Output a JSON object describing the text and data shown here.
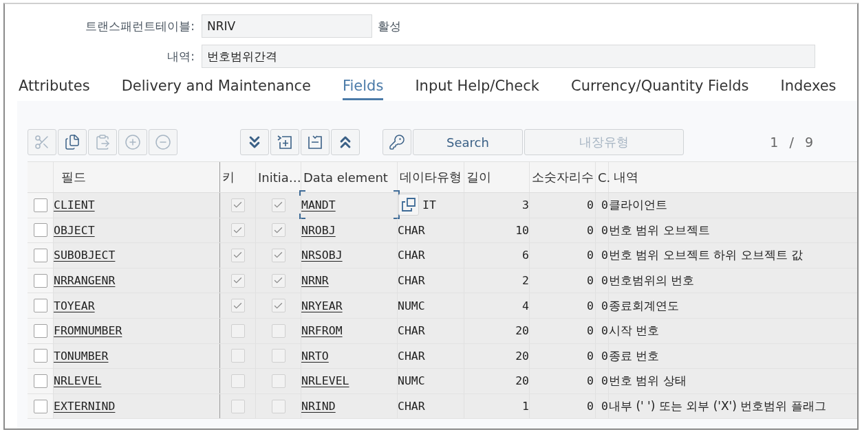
{
  "header": {
    "fields": [
      {
        "label": "트랜스패런트테이블:",
        "value": "NRIV",
        "status": "활성"
      },
      {
        "label": "내역:",
        "value": "번호범위간격"
      }
    ]
  },
  "tabs": [
    {
      "label": "Attributes",
      "selected": false
    },
    {
      "label": "Delivery and Maintenance",
      "selected": false
    },
    {
      "label": "Fields",
      "selected": true
    },
    {
      "label": "Input Help/Check",
      "selected": false
    },
    {
      "label": "Currency/Quantity Fields",
      "selected": false
    },
    {
      "label": "Indexes",
      "selected": false
    }
  ],
  "toolbar": {
    "edit_buttons": [
      {
        "kind": "cut",
        "disabled": true
      },
      {
        "kind": "copy",
        "disabled": false
      },
      {
        "kind": "paste",
        "disabled": true
      },
      {
        "kind": "add",
        "disabled": true
      },
      {
        "kind": "remove",
        "disabled": true
      }
    ],
    "nav_buttons": [
      {
        "kind": "bottom"
      },
      {
        "kind": "insert"
      },
      {
        "kind": "select"
      },
      {
        "kind": "top"
      }
    ],
    "key_button": {
      "kind": "key",
      "disabled": false
    },
    "search_button": {
      "label": "Search",
      "disabled": false
    },
    "type_button": {
      "label": "내장유형",
      "disabled": true
    },
    "page": "1 / 9"
  },
  "table": {
    "columns": [
      "필드",
      "키",
      "Initia…",
      "Data element",
      "데이타유형",
      "길이",
      "소숫자리수",
      "C.",
      "내역"
    ],
    "rows": [
      {
        "selected": false,
        "field": "CLIENT",
        "key": true,
        "initial": true,
        "data_element": "MANDT",
        "focused": true,
        "data_type": "IT",
        "length": "3",
        "decimals": "0",
        "c": "0",
        "description": "클라이언트"
      },
      {
        "selected": false,
        "field": "OBJECT",
        "key": true,
        "initial": true,
        "data_element": "NROBJ",
        "focused": false,
        "data_type": "CHAR",
        "length": "10",
        "decimals": "0",
        "c": "0",
        "description": "번호 범위 오브젝트"
      },
      {
        "selected": false,
        "field": "SUBOBJECT",
        "key": true,
        "initial": true,
        "data_element": "NRSOBJ",
        "focused": false,
        "data_type": "CHAR",
        "length": "6",
        "decimals": "0",
        "c": "0",
        "description": "번호 범위 오브젝트 하위 오브젝트 값"
      },
      {
        "selected": false,
        "field": "NRRANGENR",
        "key": true,
        "initial": true,
        "data_element": "NRNR",
        "focused": false,
        "data_type": "CHAR",
        "length": "2",
        "decimals": "0",
        "c": "0",
        "description": "번호범위의 번호"
      },
      {
        "selected": false,
        "field": "TOYEAR",
        "key": true,
        "initial": true,
        "data_element": "NRYEAR",
        "focused": false,
        "data_type": "NUMC",
        "length": "4",
        "decimals": "0",
        "c": "0",
        "description": "종료회계연도"
      },
      {
        "selected": false,
        "field": "FROMNUMBER",
        "key": false,
        "initial": false,
        "data_element": "NRFROM",
        "focused": false,
        "data_type": "CHAR",
        "length": "20",
        "decimals": "0",
        "c": "0",
        "description": "시작 번호"
      },
      {
        "selected": false,
        "field": "TONUMBER",
        "key": false,
        "initial": false,
        "data_element": "NRTO",
        "focused": false,
        "data_type": "CHAR",
        "length": "20",
        "decimals": "0",
        "c": "0",
        "description": "종료 번호"
      },
      {
        "selected": false,
        "field": "NRLEVEL",
        "key": false,
        "initial": false,
        "data_element": "NRLEVEL",
        "focused": false,
        "data_type": "NUMC",
        "length": "20",
        "decimals": "0",
        "c": "0",
        "description": "번호 범위 상태"
      },
      {
        "selected": false,
        "field": "EXTERNIND",
        "key": false,
        "initial": false,
        "data_element": "NRIND",
        "focused": false,
        "data_type": "CHAR",
        "length": "1",
        "decimals": "0",
        "c": "0",
        "description": "내부 (' ') 또는 외부 ('X') 번호범위 플래그"
      }
    ]
  }
}
